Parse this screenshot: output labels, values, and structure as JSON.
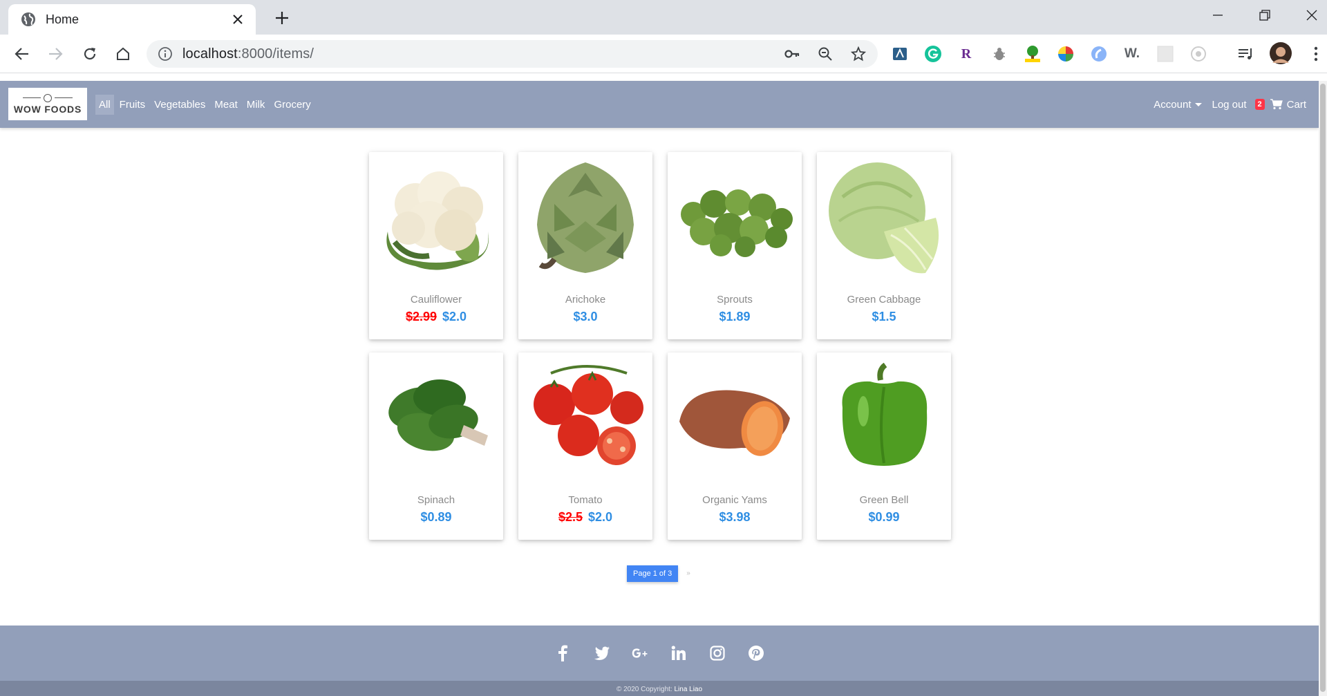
{
  "browser": {
    "tab_title": "Home",
    "url_host": "localhost",
    "url_rest": ":8000/items/"
  },
  "site": {
    "logo_text": "WOW FOODS",
    "nav": [
      {
        "label": "All",
        "active": true
      },
      {
        "label": "Fruits"
      },
      {
        "label": "Vegetables"
      },
      {
        "label": "Meat"
      },
      {
        "label": "Milk"
      },
      {
        "label": "Grocery"
      }
    ],
    "account_label": "Account",
    "logout_label": "Log out",
    "cart_count": "2",
    "cart_label": "Cart"
  },
  "products": [
    {
      "name": "Cauliflower",
      "old_price": "$2.99",
      "price": "$2.0",
      "icon": "cauliflower-image"
    },
    {
      "name": "Arichoke",
      "old_price": "",
      "price": "$3.0",
      "icon": "artichoke-image"
    },
    {
      "name": "Sprouts",
      "old_price": "",
      "price": "$1.89",
      "icon": "sprouts-image"
    },
    {
      "name": "Green Cabbage",
      "old_price": "",
      "price": "$1.5",
      "icon": "cabbage-image"
    },
    {
      "name": "Spinach",
      "old_price": "",
      "price": "$0.89",
      "icon": "spinach-image"
    },
    {
      "name": "Tomato",
      "old_price": "$2.5",
      "price": "$2.0",
      "icon": "tomato-image"
    },
    {
      "name": "Organic Yams",
      "old_price": "",
      "price": "$3.98",
      "icon": "yam-image"
    },
    {
      "name": "Green Bell",
      "old_price": "",
      "price": "$0.99",
      "icon": "bell-pepper-image"
    }
  ],
  "pagination": {
    "current_label": "Page 1 of 3",
    "next_label": "»"
  },
  "footer": {
    "social": [
      "facebook-icon",
      "twitter-icon",
      "google-plus-icon",
      "linkedin-icon",
      "instagram-icon",
      "pinterest-icon"
    ],
    "copyright": "© 2020 Copyright:",
    "author": "Lina Liao"
  },
  "colors": {
    "navbar": "#929fba",
    "price_blue": "#2f8ee3",
    "old_price_red": "#ff0000",
    "pager_blue": "#4285f4"
  }
}
